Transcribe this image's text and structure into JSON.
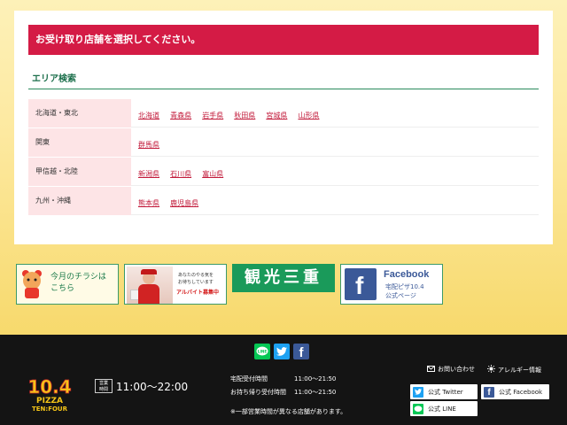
{
  "alert": {
    "text": "お受け取り店舗を選択してください。"
  },
  "area_search": {
    "title": "エリア検索",
    "rows": [
      {
        "region": "北海道・東北",
        "prefectures": [
          "北海道",
          "青森県",
          "岩手県",
          "秋田県",
          "宮城県",
          "山形県"
        ]
      },
      {
        "region": "関東",
        "prefectures": [
          "群馬県"
        ]
      },
      {
        "region": "甲信越・北陸",
        "prefectures": [
          "新潟県",
          "石川県",
          "富山県"
        ]
      },
      {
        "region": "九州・沖縄",
        "prefectures": [
          "熊本県",
          "鹿児島県"
        ]
      }
    ]
  },
  "banners": {
    "flyer": {
      "line1": "今月のチラシは",
      "line2": "こちら"
    },
    "recruit": {
      "line1": "あなたのやる気を",
      "line2": "お待ちしています",
      "line3": "アルバイト募集中"
    },
    "kanko": {
      "text": "観光三重"
    },
    "facebook": {
      "title": "Facebook",
      "line1": "宅配ピザ10.4",
      "line2": "公式ページ"
    }
  },
  "footer": {
    "logo": {
      "number": "10.4",
      "word1": "PIZZA",
      "word2": "TEN:FOUR"
    },
    "hours_badge": {
      "line1": "営業",
      "line2": "時間"
    },
    "hours": "11:00～22:00",
    "delivery": {
      "label": "宅配受付時間",
      "value": "11:00～21:50"
    },
    "takeout": {
      "label": "お持ち帰り受付時間",
      "value": "11:00～21:50"
    },
    "note": "※一部営業時間が異なる店舗があります。",
    "contact_label": "お問い合わせ",
    "allergy_label": "アレルギー情報",
    "twitter_label": "公式 Twitter",
    "facebook_label": "公式 Facebook",
    "line_label": "公式 LINE",
    "social_icons": [
      "line-icon",
      "twitter-icon",
      "facebook-icon"
    ]
  },
  "colors": {
    "accent_red": "#d41b45",
    "green": "#1a9a5a",
    "facebook_blue": "#3b5998",
    "twitter_blue": "#1da1f2",
    "line_green": "#06c755"
  }
}
